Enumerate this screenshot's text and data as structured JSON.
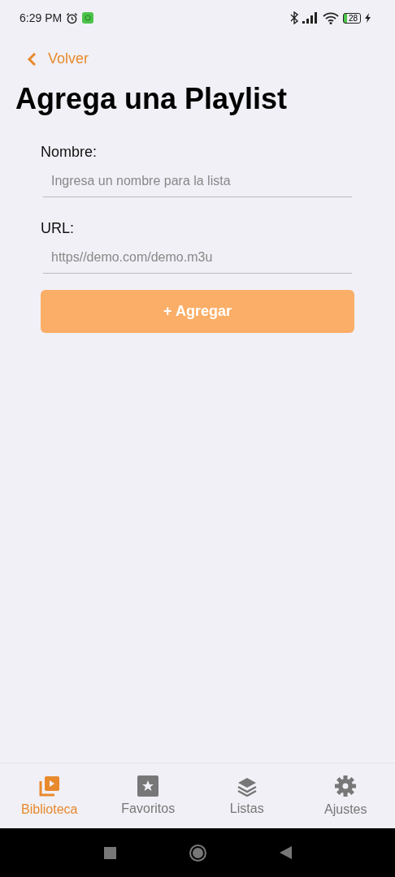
{
  "status_bar": {
    "time": "6:29 PM",
    "battery": "28"
  },
  "back": {
    "label": "Volver"
  },
  "title": "Agrega una Playlist",
  "form": {
    "fields": [
      {
        "label": "Nombre:",
        "placeholder": "Ingresa un nombre para la lista"
      },
      {
        "label": "URL:",
        "placeholder": "https//demo.com/demo.m3u"
      }
    ],
    "submit": "+ Agregar"
  },
  "tabs": [
    {
      "kind": "library",
      "label": "Biblioteca",
      "selected": true
    },
    {
      "kind": "favorites",
      "label": "Favoritos",
      "selected": false
    },
    {
      "kind": "lists",
      "label": "Listas",
      "selected": false
    },
    {
      "kind": "settings",
      "label": "Ajustes",
      "selected": false
    }
  ]
}
